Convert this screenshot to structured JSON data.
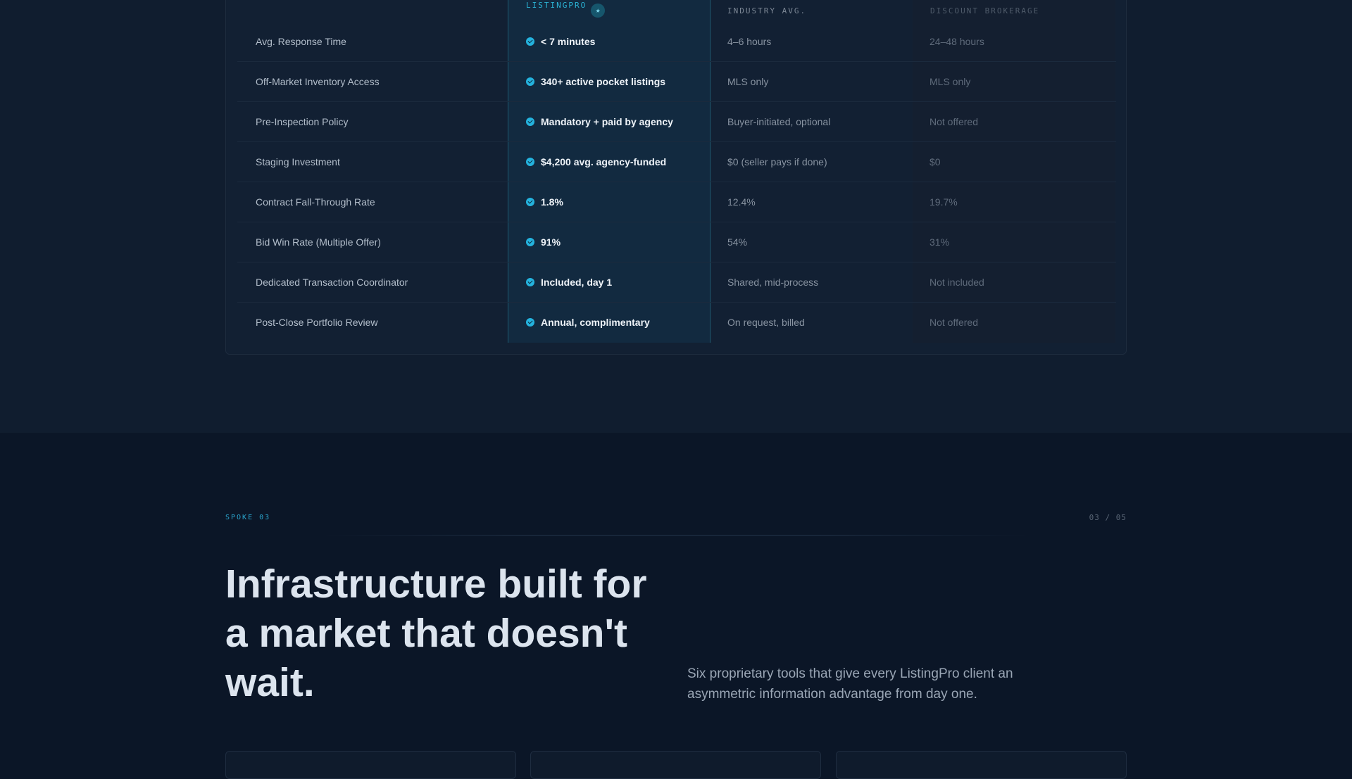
{
  "comparison": {
    "headers": {
      "listingpro": "LISTINGPRO",
      "listingpro_badge": "★",
      "industry": "INDUSTRY AVG.",
      "discount": "DISCOUNT BROKERAGE"
    },
    "rows": [
      {
        "feature": "Avg. Response Time",
        "listingpro": "< 7 minutes",
        "industry": "4–6 hours",
        "discount": "24–48 hours"
      },
      {
        "feature": "Off-Market Inventory Access",
        "listingpro": "340+ active pocket listings",
        "industry": "MLS only",
        "discount": "MLS only"
      },
      {
        "feature": "Pre-Inspection Policy",
        "listingpro": "Mandatory + paid by agency",
        "industry": "Buyer-initiated, optional",
        "discount": "Not offered"
      },
      {
        "feature": "Staging Investment",
        "listingpro": "$4,200 avg. agency-funded",
        "industry": "$0 (seller pays if done)",
        "discount": "$0"
      },
      {
        "feature": "Contract Fall-Through Rate",
        "listingpro": "1.8%",
        "industry": "12.4%",
        "discount": "19.7%"
      },
      {
        "feature": "Bid Win Rate (Multiple Offer)",
        "listingpro": "91%",
        "industry": "54%",
        "discount": "31%"
      },
      {
        "feature": "Dedicated Transaction Coordinator",
        "listingpro": "Included, day 1",
        "industry": "Shared, mid-process",
        "discount": "Not included"
      },
      {
        "feature": "Post-Close Portfolio Review",
        "listingpro": "Annual, complimentary",
        "industry": "On request, billed",
        "discount": "Not offered"
      }
    ]
  },
  "spoke": {
    "label": "SPOKE 03",
    "counter": "03 / 05",
    "headline": "Infrastructure built for a market that doesn't wait.",
    "subtext": "Six proprietary tools that give every ListingPro client an asymmetric information advantage from day one."
  },
  "colors": {
    "accent": "#24b3de",
    "background": "#0b1627",
    "table_background": "#122033"
  }
}
